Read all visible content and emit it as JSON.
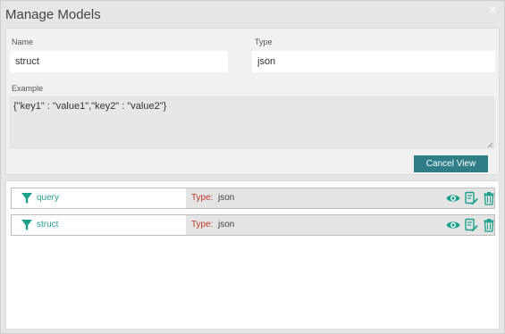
{
  "dialog": {
    "title": "Manage Models",
    "close_glyph": "×"
  },
  "form": {
    "name_label": "Name",
    "name_value": "struct",
    "type_label": "Type",
    "type_value": "json",
    "example_label": "Example",
    "example_value": "{\"key1\" : \"value1\",\"key2\" : \"value2\"}",
    "cancel_view_label": "Cancel View"
  },
  "models": [
    {
      "name": "query",
      "type_label": "Type:",
      "type_value": "json",
      "icon": "filter-icon"
    },
    {
      "name": "struct",
      "type_label": "Type:",
      "type_value": "json",
      "icon": "filter-icon"
    }
  ],
  "row_actions": [
    "eye-icon",
    "edit-icon",
    "trash-icon"
  ],
  "colors": {
    "accent": "#2e7d87",
    "teal_icon": "#1aa08a",
    "type_label": "#c0392b"
  }
}
